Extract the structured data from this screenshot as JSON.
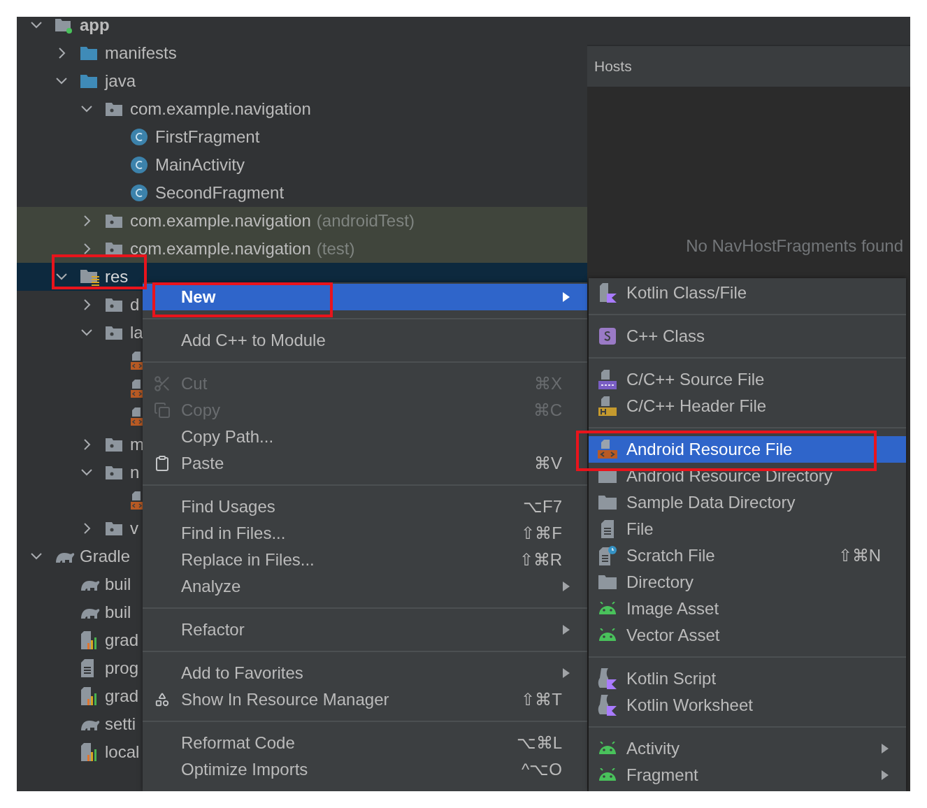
{
  "tree": [
    {
      "label": "app",
      "kind": "module",
      "expanded": true,
      "children": [
        {
          "label": "manifests",
          "kind": "folder",
          "expanded": false
        },
        {
          "label": "java",
          "kind": "folder",
          "expanded": true,
          "children": [
            {
              "label": "com.example.navigation",
              "kind": "package",
              "expanded": true,
              "children": [
                {
                  "label": "FirstFragment",
                  "kind": "class"
                },
                {
                  "label": "MainActivity",
                  "kind": "class"
                },
                {
                  "label": "SecondFragment",
                  "kind": "class"
                }
              ]
            },
            {
              "label": "com.example.navigation",
              "suffix": "(androidTest)",
              "test_source": true,
              "kind": "package",
              "expanded": false
            },
            {
              "label": "com.example.navigation",
              "suffix": "(test)",
              "test_source": true,
              "kind": "package",
              "expanded": false
            }
          ]
        },
        {
          "label": "res",
          "kind": "res-folder",
          "expanded": true,
          "selected": true,
          "annotated": true,
          "children": [
            {
              "label": "d",
              "kind": "package",
              "expanded": false
            },
            {
              "label": "la",
              "kind": "package",
              "expanded": true,
              "children": [
                {
                  "kind": "layout-file"
                },
                {
                  "kind": "layout-file"
                },
                {
                  "kind": "layout-file"
                }
              ]
            },
            {
              "label": "m",
              "kind": "package",
              "expanded": false
            },
            {
              "label": "n",
              "kind": "package",
              "expanded": true,
              "children": [
                {
                  "kind": "layout-file"
                }
              ]
            },
            {
              "label": "v",
              "kind": "package",
              "expanded": false
            }
          ]
        }
      ]
    },
    {
      "label": "Gradle",
      "kind": "gradle",
      "expanded": true,
      "children": [
        {
          "label": "buil",
          "kind": "gradle"
        },
        {
          "label": "buil",
          "kind": "gradle"
        },
        {
          "label": "grad",
          "kind": "properties-file"
        },
        {
          "label": "prog",
          "kind": "text-file"
        },
        {
          "label": "grad",
          "kind": "properties-file"
        },
        {
          "label": "setti",
          "kind": "gradle"
        },
        {
          "label": "local",
          "kind": "properties-file"
        }
      ]
    }
  ],
  "right_panel": {
    "header": "Hosts",
    "empty_message": "No NavHostFragments found"
  },
  "context_menu": {
    "groups": [
      {
        "items": [
          {
            "label": "New",
            "submenu": true,
            "selected": true,
            "annotated": true
          }
        ]
      },
      {
        "items": [
          {
            "label": "Add C++ to Module"
          }
        ]
      },
      {
        "items": [
          {
            "label": "Cut",
            "kind": "cut",
            "shortcut": "⌘X",
            "disabled": true
          },
          {
            "label": "Copy",
            "kind": "copy",
            "shortcut": "⌘C",
            "disabled": true
          },
          {
            "label": "Copy Path..."
          },
          {
            "label": "Paste",
            "kind": "paste",
            "shortcut": "⌘V"
          }
        ]
      },
      {
        "items": [
          {
            "label": "Find Usages",
            "shortcut": "⌥F7"
          },
          {
            "label": "Find in Files...",
            "shortcut": "⇧⌘F"
          },
          {
            "label": "Replace in Files...",
            "shortcut": "⇧⌘R"
          },
          {
            "label": "Analyze",
            "submenu": true
          }
        ]
      },
      {
        "items": [
          {
            "label": "Refactor",
            "submenu": true
          }
        ]
      },
      {
        "items": [
          {
            "label": "Add to Favorites",
            "submenu": true
          },
          {
            "label": "Show In Resource Manager",
            "kind": "shapes",
            "shortcut": "⇧⌘T"
          }
        ]
      },
      {
        "items": [
          {
            "label": "Reformat Code",
            "shortcut": "⌥⌘L"
          },
          {
            "label": "Optimize Imports",
            "shortcut": "^⌥O"
          }
        ]
      }
    ]
  },
  "new_submenu": {
    "groups": [
      {
        "items": [
          {
            "label": "Kotlin Class/File",
            "kind": "kotlin-file"
          }
        ]
      },
      {
        "items": [
          {
            "label": "C++ Class",
            "kind": "cpp-class"
          }
        ]
      },
      {
        "items": [
          {
            "label": "C/C++ Source File",
            "kind": "cpp-source"
          },
          {
            "label": "C/C++ Header File",
            "kind": "cpp-header"
          }
        ]
      },
      {
        "items": [
          {
            "label": "Android Resource File",
            "kind": "resource-file",
            "selected": true,
            "annotated": true
          },
          {
            "label": "Android Resource Directory",
            "kind": "folder"
          },
          {
            "label": "Sample Data Directory",
            "kind": "folder"
          },
          {
            "label": "File",
            "kind": "file"
          },
          {
            "label": "Scratch File",
            "kind": "scratch-file",
            "shortcut": "⇧⌘N"
          },
          {
            "label": "Directory",
            "kind": "folder"
          },
          {
            "label": "Image Asset",
            "kind": "android"
          },
          {
            "label": "Vector Asset",
            "kind": "android"
          }
        ]
      },
      {
        "items": [
          {
            "label": "Kotlin Script",
            "kind": "kotlin-script"
          },
          {
            "label": "Kotlin Worksheet",
            "kind": "kotlin-script"
          }
        ]
      },
      {
        "items": [
          {
            "label": "Activity",
            "kind": "android",
            "submenu": true
          },
          {
            "label": "Fragment",
            "kind": "android",
            "submenu": true
          }
        ]
      }
    ]
  }
}
